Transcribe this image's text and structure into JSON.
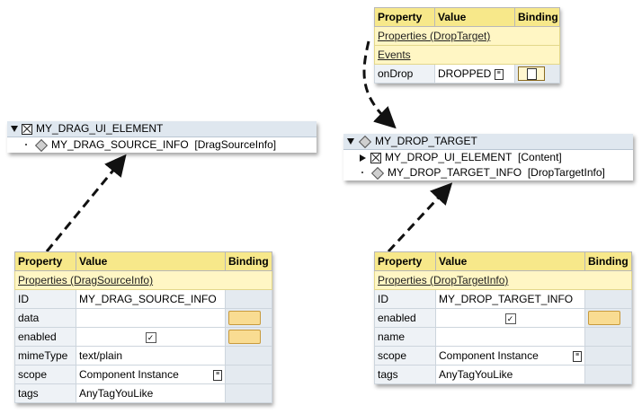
{
  "drop_events": {
    "headers": {
      "property": "Property",
      "value": "Value",
      "binding": "Binding"
    },
    "section1": "Properties (DropTarget)",
    "section2": "Events",
    "row": {
      "label": "onDrop",
      "value": "DROPPED"
    }
  },
  "drag_tree": {
    "root": "MY_DRAG_UI_ELEMENT",
    "child": "MY_DRAG_SOURCE_INFO",
    "child_type": "[DragSourceInfo]"
  },
  "drop_tree": {
    "root": "MY_DROP_TARGET",
    "child1": "MY_DROP_UI_ELEMENT",
    "child1_type": "[Content]",
    "child2": "MY_DROP_TARGET_INFO",
    "child2_type": "[DropTargetInfo]"
  },
  "drag_props": {
    "headers": {
      "property": "Property",
      "value": "Value",
      "binding": "Binding"
    },
    "section": "Properties (DragSourceInfo)",
    "rows": [
      {
        "label": "ID",
        "value": "MY_DRAG_SOURCE_INFO"
      },
      {
        "label": "data",
        "value": ""
      },
      {
        "label": "enabled",
        "value": "✓"
      },
      {
        "label": "mimeType",
        "value": "text/plain"
      },
      {
        "label": "scope",
        "value": "Component Instance"
      },
      {
        "label": "tags",
        "value": "AnyTagYouLike"
      }
    ]
  },
  "drop_props": {
    "headers": {
      "property": "Property",
      "value": "Value",
      "binding": "Binding"
    },
    "section": "Properties (DropTargetInfo)",
    "rows": [
      {
        "label": "ID",
        "value": "MY_DROP_TARGET_INFO"
      },
      {
        "label": "enabled",
        "value": "✓"
      },
      {
        "label": "name",
        "value": ""
      },
      {
        "label": "scope",
        "value": "Component Instance"
      },
      {
        "label": "tags",
        "value": "AnyTagYouLike"
      }
    ]
  }
}
